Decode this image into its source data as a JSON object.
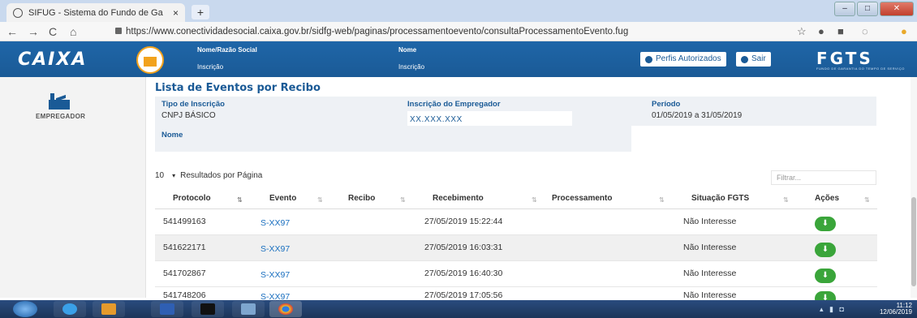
{
  "browser": {
    "tab_title": "SIFUG - Sistema do Fundo de Ga",
    "tab_close": "×",
    "new_tab": "+",
    "url": "https://www.conectividadesocial.caixa.gov.br/sidfg-web/paginas/processamentoevento/consultaProcessamentoEvento.fug",
    "nav_back": "←",
    "nav_forward": "→",
    "nav_reload": "C",
    "nav_home": "⌂",
    "ext_star": "☆"
  },
  "header": {
    "brand": "CAIXA",
    "field1_label": "Nome/Razão Social",
    "field1_sub": "Inscrição",
    "field2_label": "Nome",
    "field2_sub": "Inscrição",
    "perfis_label": "Perfis Autorizados",
    "sair_label": "Sair",
    "fgts_logo": "FGTS",
    "fgts_sub": "FUNDO DE GARANTIA DO TEMPO DE SERVIÇO"
  },
  "sidebar": {
    "item_label": "EMPREGADOR"
  },
  "page": {
    "title": "Lista de Eventos por Recibo",
    "tipo_label": "Tipo de Inscrição",
    "tipo_value": "CNPJ BÁSICO",
    "inscr_label": "Inscrição do Empregador",
    "inscr_value": "XX.XXX.XXX",
    "periodo_label": "Período",
    "periodo_value": "01/05/2019 a 31/05/2019",
    "nome_label": "Nome"
  },
  "table": {
    "page_size": "10",
    "page_size_caret": "▾",
    "results_label": "Resultados por Página",
    "filter_placeholder": "Filtrar...",
    "headers": {
      "protocolo": "Protocolo",
      "evento": "Evento",
      "recibo": "Recibo",
      "recebimento": "Recebimento",
      "processamento": "Processamento",
      "situacao": "Situação FGTS",
      "acoes": "Ações"
    },
    "sort_active": "⇅",
    "sort_inactive": "⇅",
    "rows": [
      {
        "protocolo": "541499163",
        "evento": "S-XX97",
        "recibo": "",
        "recebimento": "27/05/2019 15:22:44",
        "processamento": "",
        "situacao": "Não Interesse"
      },
      {
        "protocolo": "541622171",
        "evento": "S-XX97",
        "recibo": "",
        "recebimento": "27/05/2019 16:03:31",
        "processamento": "",
        "situacao": "Não Interesse"
      },
      {
        "protocolo": "541702867",
        "evento": "S-XX97",
        "recibo": "",
        "recebimento": "27/05/2019 16:40:30",
        "processamento": "",
        "situacao": "Não Interesse"
      },
      {
        "protocolo": "541748206",
        "evento": "S-XX97",
        "recibo": "",
        "recebimento": "27/05/2019 17:05:56",
        "processamento": "",
        "situacao": "Não Interesse"
      }
    ],
    "download_glyph": "⬇"
  },
  "taskbar": {
    "clock_time": "11:12",
    "clock_date": "12/06/2019"
  }
}
